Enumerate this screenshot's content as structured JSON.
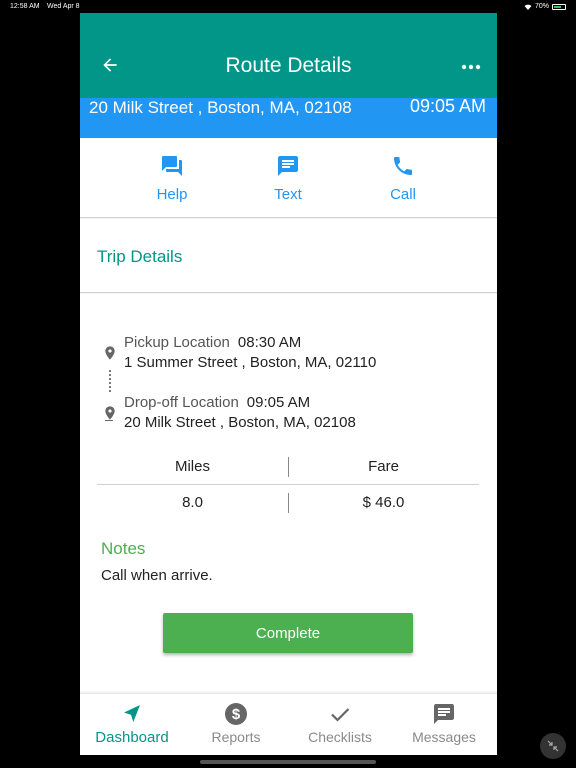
{
  "status_bar": {
    "time": "12:58 AM",
    "date": "Wed Apr 8",
    "battery": "70%"
  },
  "app_bar": {
    "title": "Route Details"
  },
  "destination": {
    "address": "20 Milk Street , Boston, MA, 02108",
    "time": "09:05 AM"
  },
  "actions": [
    {
      "label": "Help",
      "icon": "forum-icon"
    },
    {
      "label": "Text",
      "icon": "message-icon"
    },
    {
      "label": "Call",
      "icon": "phone-icon"
    }
  ],
  "trip": {
    "title": "Trip Details",
    "pickup": {
      "label": "Pickup Location",
      "time": "08:30 AM",
      "address": "1 Summer Street , Boston, MA, 02110"
    },
    "dropoff": {
      "label": "Drop-off Location",
      "time": "09:05 AM",
      "address": "20 Milk Street , Boston, MA, 02108"
    }
  },
  "summary": {
    "miles_label": "Miles",
    "fare_label": "Fare",
    "miles": "8.0",
    "fare": "$ 46.0"
  },
  "notes": {
    "title": "Notes",
    "text": "Call when arrive."
  },
  "complete_label": "Complete",
  "bottom_nav": [
    {
      "label": "Dashboard",
      "icon": "navigation-arrow-icon",
      "active": true
    },
    {
      "label": "Reports",
      "icon": "dollar-circle-icon",
      "active": false
    },
    {
      "label": "Checklists",
      "icon": "checkmark-icon",
      "active": false
    },
    {
      "label": "Messages",
      "icon": "message-icon",
      "active": false
    }
  ],
  "colors": {
    "teal": "#019688",
    "blue": "#2196f3",
    "green": "#4caf50"
  }
}
